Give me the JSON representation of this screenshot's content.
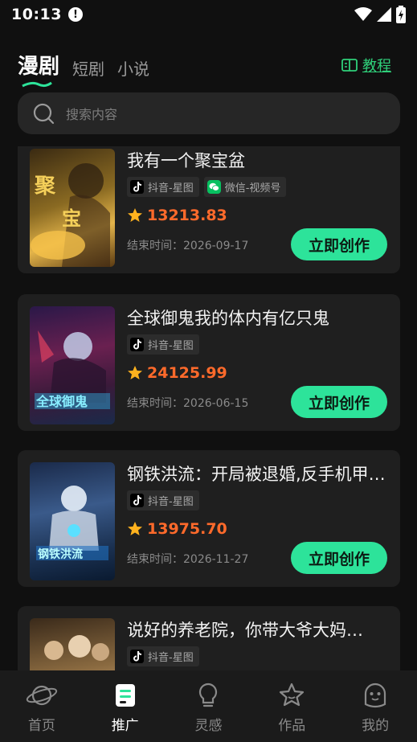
{
  "status_bar": {
    "time": "10:13",
    "alert": "!"
  },
  "tabs": [
    {
      "label": "漫剧",
      "active": true
    },
    {
      "label": "短剧",
      "active": false
    },
    {
      "label": "小说",
      "active": false
    }
  ],
  "tutorial": {
    "label": "教程",
    "icon": "book-icon"
  },
  "search": {
    "placeholder": "搜索内容",
    "icon": "search-icon"
  },
  "colors": {
    "accent": "#2de39a",
    "score": "#ff6a2b",
    "card_bg": "#1f1f1f",
    "page_bg": "#101010"
  },
  "cards": [
    {
      "title": "我有一个聚宝盆",
      "tags": [
        {
          "label": "抖音-星图",
          "icon": "tiktok-icon"
        },
        {
          "label": "微信-视频号",
          "icon": "wechat-icon"
        }
      ],
      "score": "13213.83",
      "end_time": "结束时间：2026-09-17",
      "button": "立即创作"
    },
    {
      "title": "全球御鬼我的体内有亿只鬼",
      "tags": [
        {
          "label": "抖音-星图",
          "icon": "tiktok-icon"
        }
      ],
      "score": "24125.99",
      "end_time": "结束时间：2026-06-15",
      "button": "立即创作"
    },
    {
      "title": "钢铁洪流：开局被退婚,反手机甲…",
      "tags": [
        {
          "label": "抖音-星图",
          "icon": "tiktok-icon"
        }
      ],
      "score": "13975.70",
      "end_time": "结束时间：2026-11-27",
      "button": "立即创作"
    },
    {
      "title": "说好的养老院，你带大爷大妈…",
      "tags": [
        {
          "label": "抖音-星图",
          "icon": "tiktok-icon"
        }
      ]
    }
  ],
  "bottom_nav": [
    {
      "label": "首页",
      "icon": "planet-icon",
      "active": false
    },
    {
      "label": "推广",
      "icon": "promote-icon",
      "active": true
    },
    {
      "label": "灵感",
      "icon": "lightbulb-icon",
      "active": false
    },
    {
      "label": "作品",
      "icon": "star-icon",
      "active": false
    },
    {
      "label": "我的",
      "icon": "profile-icon",
      "active": false
    }
  ]
}
